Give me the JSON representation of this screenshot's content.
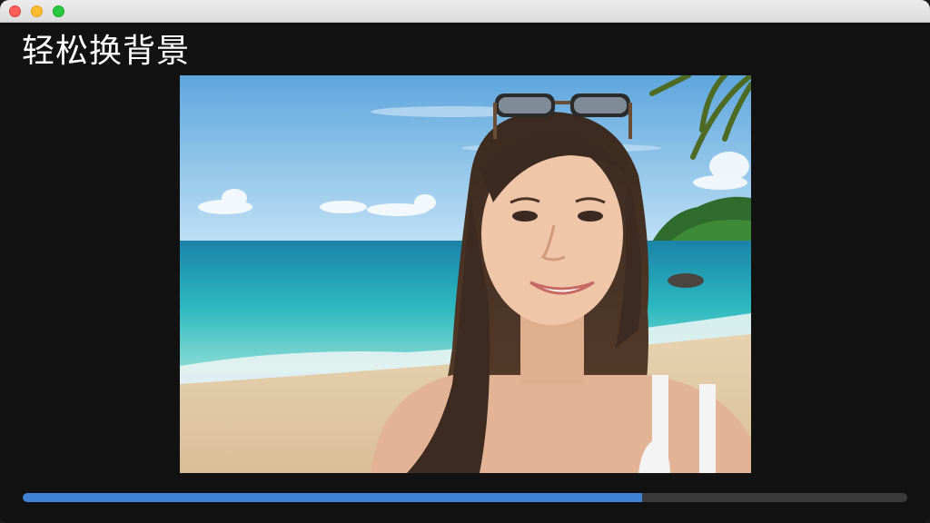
{
  "window": {
    "title_text": "轻松换背景"
  },
  "photo": {
    "description_icon": "portrait-photo-beach"
  },
  "progress": {
    "value": 0.7
  },
  "colors": {
    "accent": "#3e82d6",
    "track": "#3a3a3a",
    "background": "#121212"
  }
}
